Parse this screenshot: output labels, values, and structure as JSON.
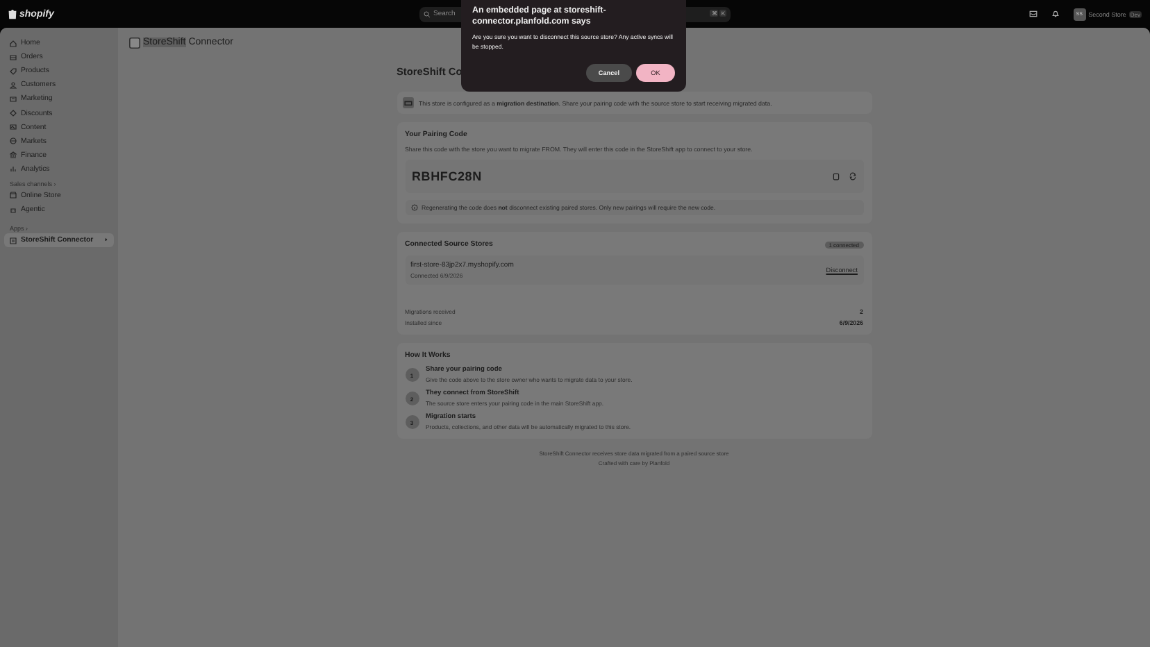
{
  "topbar": {
    "logo": "shopify",
    "search": {
      "placeholder": "Search",
      "keys": [
        "⌘",
        "K"
      ]
    },
    "store": {
      "initials": "SS",
      "name": "Second Store",
      "badge": "Dev"
    }
  },
  "sidebar": {
    "items": [
      {
        "label": "Home",
        "selected": false
      },
      {
        "label": "Orders",
        "selected": false
      },
      {
        "label": "Products",
        "selected": false
      },
      {
        "label": "Customers",
        "selected": false
      },
      {
        "label": "Marketing",
        "selected": false
      },
      {
        "label": "Discounts",
        "selected": false
      },
      {
        "label": "Content",
        "selected": false
      },
      {
        "label": "Markets",
        "selected": false
      },
      {
        "label": "Finance",
        "selected": false
      },
      {
        "label": "Analytics",
        "selected": false
      }
    ],
    "sales_channels": {
      "heading": "Sales channels",
      "chevron": "›",
      "items": [
        {
          "label": "Online Store",
          "selected": false
        },
        {
          "label": "Agentic",
          "selected": false
        }
      ]
    },
    "apps": {
      "heading": "Apps",
      "chevron": "›",
      "items": [
        {
          "label": "StoreShift Connector",
          "selected": true
        }
      ]
    }
  },
  "app_header": {
    "title_bold": "StoreShift",
    "title_rest": "Connector"
  },
  "page": {
    "title": "StoreShift Co",
    "banner": "This store is configured as a **migration destination**. Share your pairing code with the source store to start receiving migrated data.",
    "pairing": {
      "heading": "Your Pairing Code",
      "description": "Share this code with the store you want to migrate FROM. They will enter this code in the StoreShift app to connect to your store.",
      "code": "RBHFC28N",
      "note": "Regenerating the code does **not** disconnect existing paired stores. Only new pairings will require the new code."
    },
    "connected": {
      "heading": "Connected Source Stores",
      "badge": "1 connected",
      "stores": [
        {
          "domain": "first-store-83jp2x7.myshopify.com",
          "connected": "Connected 6/9/2026",
          "action": "Disconnect"
        }
      ],
      "stats": [
        {
          "label": "Migrations received",
          "value": "2"
        },
        {
          "label": "Installed since",
          "value": "6/9/2026"
        }
      ]
    },
    "how": {
      "heading": "How It Works",
      "steps": [
        {
          "number": "1",
          "title": "Share your pairing code",
          "text": "Give the code above to the store owner who wants to migrate data to your store."
        },
        {
          "number": "2",
          "title": "They connect from StoreShift",
          "text": "The source store enters your pairing code in the main StoreShift app."
        },
        {
          "number": "3",
          "title": "Migration starts",
          "text": "Products, collections, and other data will be automatically migrated to this store."
        }
      ]
    },
    "footer": [
      "StoreShift Connector receives store data migrated from a paired source store",
      "Crafted with care by Planfold"
    ]
  },
  "dialog": {
    "title": "An embedded page at storeshift-connector.planfold.com says",
    "message": "Are you sure you want to disconnect this source store? Any active syncs will be stopped.",
    "buttons": [
      {
        "label": "Cancel",
        "kind": "secondary"
      },
      {
        "label": "OK",
        "kind": "primary"
      }
    ]
  }
}
